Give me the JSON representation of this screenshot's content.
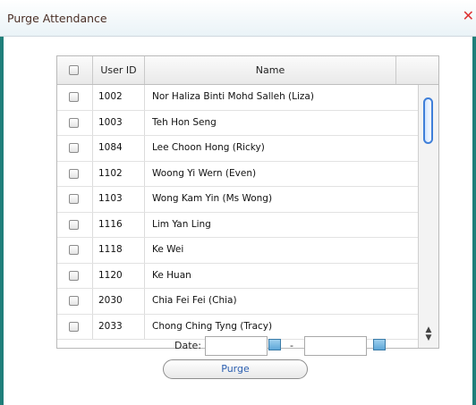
{
  "window": {
    "title": "Purge Attendance",
    "close_icon": "close-icon"
  },
  "grid": {
    "columns": [
      "User ID",
      "Name"
    ],
    "rows": [
      {
        "id": "1002",
        "name": "Nor Haliza Binti Mohd Salleh (Liza)"
      },
      {
        "id": "1003",
        "name": "Teh Hon Seng"
      },
      {
        "id": "1084",
        "name": "Lee Choon Hong (Ricky)"
      },
      {
        "id": "1102",
        "name": "Woong Yi Wern (Even)"
      },
      {
        "id": "1103",
        "name": "Wong Kam Yin (Ms Wong)"
      },
      {
        "id": "1116",
        "name": "Lim Yan Ling"
      },
      {
        "id": "1118",
        "name": "Ke Wei"
      },
      {
        "id": "1120",
        "name": "Ke Huan"
      },
      {
        "id": "2030",
        "name": "Chia Fei Fei (Chia)"
      },
      {
        "id": "2033",
        "name": "Chong Ching Tyng (Tracy)"
      }
    ]
  },
  "date_filter": {
    "label": "Date:",
    "separator": "-",
    "from_value": "",
    "to_value": ""
  },
  "actions": {
    "purge_label": "Purge"
  }
}
